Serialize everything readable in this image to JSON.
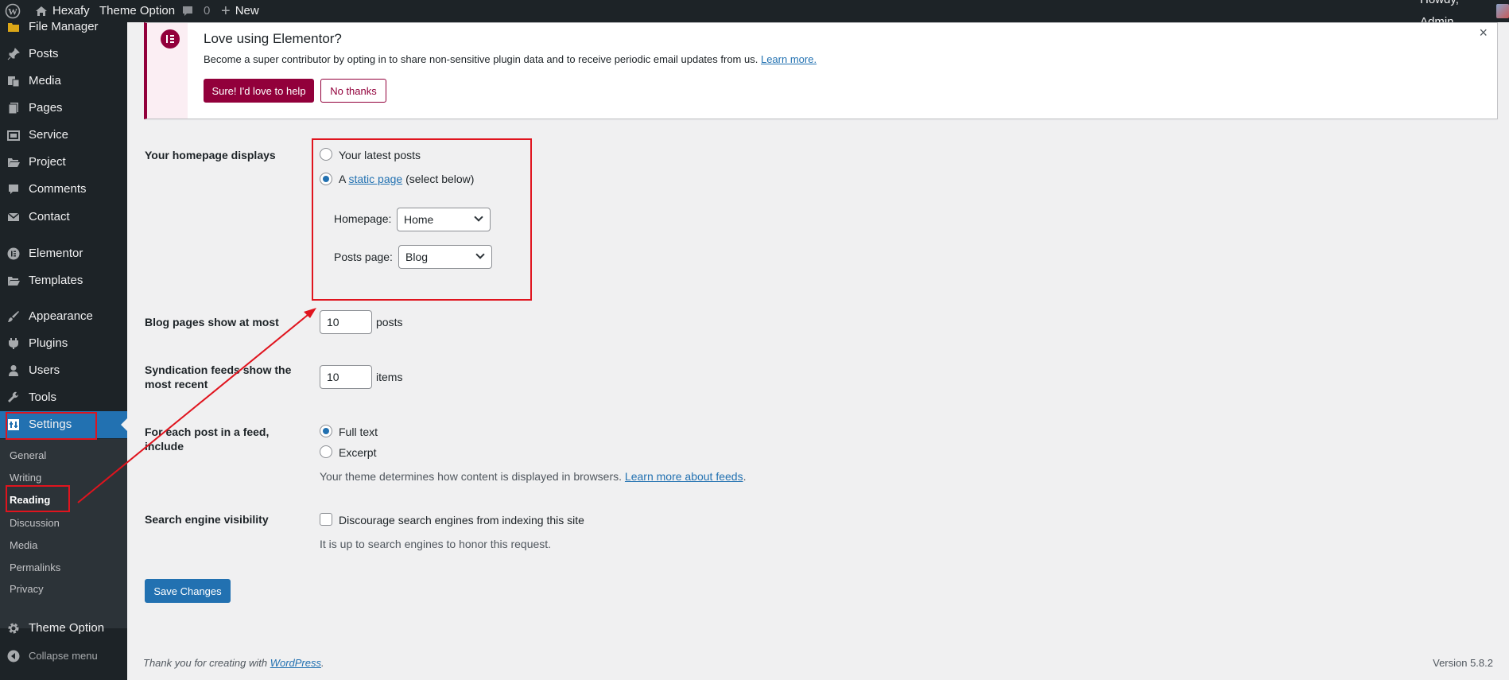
{
  "admin_bar": {
    "site_name": "Hexafy",
    "theme_option": "Theme Option",
    "comments_count": "0",
    "new_label": "New",
    "howdy": "Howdy, Admin"
  },
  "sidebar": {
    "items": [
      {
        "label": "File Manager",
        "icon": "folder-icon"
      },
      {
        "label": "Posts",
        "icon": "pin-icon"
      },
      {
        "label": "Media",
        "icon": "media-icon"
      },
      {
        "label": "Pages",
        "icon": "pages-icon"
      },
      {
        "label": "Service",
        "icon": "portfolio-icon"
      },
      {
        "label": "Project",
        "icon": "folder-open-icon"
      },
      {
        "label": "Comments",
        "icon": "comment-icon"
      },
      {
        "label": "Contact",
        "icon": "mail-icon"
      },
      {
        "label": "Elementor",
        "icon": "elementor-icon"
      },
      {
        "label": "Templates",
        "icon": "folder-open-icon"
      },
      {
        "label": "Appearance",
        "icon": "brush-icon"
      },
      {
        "label": "Plugins",
        "icon": "plug-icon"
      },
      {
        "label": "Users",
        "icon": "user-icon"
      },
      {
        "label": "Tools",
        "icon": "wrench-icon"
      },
      {
        "label": "Settings",
        "icon": "settings-icon"
      }
    ],
    "submenu": [
      "General",
      "Writing",
      "Reading",
      "Discussion",
      "Media",
      "Permalinks",
      "Privacy"
    ],
    "theme_option": "Theme Option",
    "collapse": "Collapse menu"
  },
  "notice": {
    "title": "Love using Elementor?",
    "text": "Become a super contributor by opting in to share non-sensitive plugin data and to receive periodic email updates from us.",
    "learn_more": "Learn more.",
    "primary_button": "Sure! I'd love to help",
    "secondary_button": "No thanks"
  },
  "form": {
    "homepage_displays": {
      "label": "Your homepage displays",
      "option_latest": "Your latest posts",
      "option_static_prefix": "A",
      "option_static_link": "static page",
      "option_static_suffix": "(select below)",
      "homepage_label": "Homepage:",
      "homepage_value": "Home",
      "posts_page_label": "Posts page:",
      "posts_page_value": "Blog"
    },
    "blog_pages": {
      "label": "Blog pages show at most",
      "value": "10",
      "unit": "posts"
    },
    "syndication": {
      "label_line1": "Syndication feeds show the",
      "label_line2": "most recent",
      "value": "10",
      "unit": "items"
    },
    "feed_include": {
      "label_line1": "For each post in a feed,",
      "label_line2": "include",
      "option_full": "Full text",
      "option_excerpt": "Excerpt",
      "desc": "Your theme determines how content is displayed in browsers.",
      "desc_link": "Learn more about feeds",
      "desc_end": "."
    },
    "search_visibility": {
      "label": "Search engine visibility",
      "checkbox_label": "Discourage search engines from indexing this site",
      "desc": "It is up to search engines to honor this request."
    },
    "save_button": "Save Changes"
  },
  "footer": {
    "thanks_prefix": "Thank you for creating with",
    "thanks_link": "WordPress",
    "thanks_end": ".",
    "version": "Version 5.8.2"
  },
  "colors": {
    "admin_dark": "#1d2327",
    "accent_blue": "#2271b1",
    "elementor": "#92003b",
    "annotation_red": "#e0141e"
  }
}
